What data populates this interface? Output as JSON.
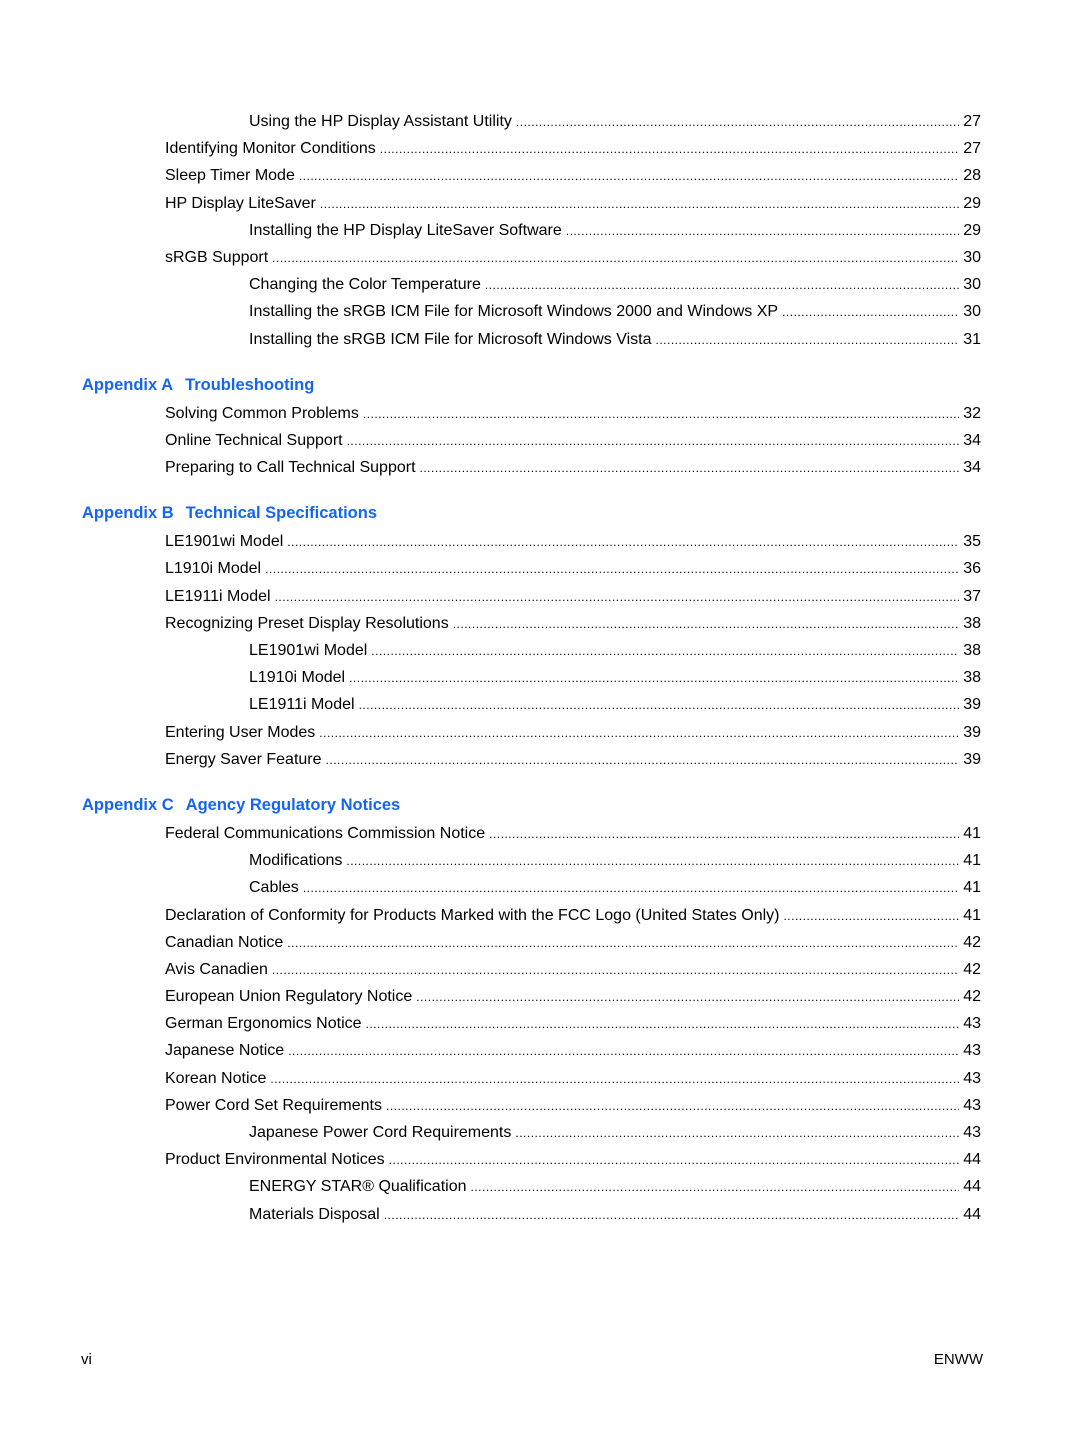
{
  "accent_color": "#1565f0",
  "toc": [
    {
      "type": "entry",
      "level": 2,
      "title": "Using the HP Display Assistant Utility",
      "page": "27"
    },
    {
      "type": "entry",
      "level": 1,
      "title": "Identifying Monitor Conditions",
      "page": "27"
    },
    {
      "type": "entry",
      "level": 1,
      "title": "Sleep Timer Mode",
      "page": "28"
    },
    {
      "type": "entry",
      "level": 1,
      "title": "HP Display LiteSaver",
      "page": "29"
    },
    {
      "type": "entry",
      "level": 2,
      "title": "Installing the HP Display LiteSaver Software",
      "page": "29"
    },
    {
      "type": "entry",
      "level": 1,
      "title": "sRGB Support",
      "page": "30"
    },
    {
      "type": "entry",
      "level": 2,
      "title": "Changing the Color Temperature",
      "page": "30"
    },
    {
      "type": "entry",
      "level": 2,
      "title": "Installing the sRGB ICM File for Microsoft Windows 2000 and Windows XP",
      "page": "30"
    },
    {
      "type": "entry",
      "level": 2,
      "title": "Installing the sRGB ICM File for Microsoft Windows Vista",
      "page": "31"
    },
    {
      "type": "heading",
      "label": "Appendix A",
      "title": "Troubleshooting"
    },
    {
      "type": "entry",
      "level": 1,
      "title": "Solving Common Problems",
      "page": "32"
    },
    {
      "type": "entry",
      "level": 1,
      "title": "Online Technical Support",
      "page": "34"
    },
    {
      "type": "entry",
      "level": 1,
      "title": "Preparing to Call Technical Support",
      "page": "34"
    },
    {
      "type": "heading",
      "label": "Appendix B",
      "title": "Technical Specifications"
    },
    {
      "type": "entry",
      "level": 1,
      "title": "LE1901wi Model",
      "page": "35"
    },
    {
      "type": "entry",
      "level": 1,
      "title": "L1910i Model",
      "page": "36"
    },
    {
      "type": "entry",
      "level": 1,
      "title": "LE1911i Model",
      "page": "37"
    },
    {
      "type": "entry",
      "level": 1,
      "title": "Recognizing Preset Display Resolutions",
      "page": "38"
    },
    {
      "type": "entry",
      "level": 2,
      "title": "LE1901wi Model",
      "page": "38"
    },
    {
      "type": "entry",
      "level": 2,
      "title": "L1910i Model",
      "page": "38"
    },
    {
      "type": "entry",
      "level": 2,
      "title": "LE1911i Model",
      "page": "39"
    },
    {
      "type": "entry",
      "level": 1,
      "title": "Entering User Modes",
      "page": "39"
    },
    {
      "type": "entry",
      "level": 1,
      "title": "Energy Saver Feature",
      "page": "39"
    },
    {
      "type": "heading",
      "label": "Appendix C",
      "title": "Agency Regulatory Notices"
    },
    {
      "type": "entry",
      "level": 1,
      "title": "Federal Communications Commission Notice",
      "page": "41"
    },
    {
      "type": "entry",
      "level": 2,
      "title": "Modifications",
      "page": "41"
    },
    {
      "type": "entry",
      "level": 2,
      "title": "Cables",
      "page": "41"
    },
    {
      "type": "entry",
      "level": 1,
      "title": "Declaration of Conformity for Products Marked with the FCC Logo (United States Only)",
      "page": "41"
    },
    {
      "type": "entry",
      "level": 1,
      "title": "Canadian Notice",
      "page": "42"
    },
    {
      "type": "entry",
      "level": 1,
      "title": "Avis Canadien",
      "page": "42"
    },
    {
      "type": "entry",
      "level": 1,
      "title": "European Union Regulatory Notice",
      "page": "42"
    },
    {
      "type": "entry",
      "level": 1,
      "title": "German Ergonomics Notice",
      "page": "43"
    },
    {
      "type": "entry",
      "level": 1,
      "title": "Japanese Notice",
      "page": "43"
    },
    {
      "type": "entry",
      "level": 1,
      "title": "Korean Notice",
      "page": "43"
    },
    {
      "type": "entry",
      "level": 1,
      "title": "Power Cord Set Requirements",
      "page": "43"
    },
    {
      "type": "entry",
      "level": 2,
      "title": "Japanese Power Cord Requirements",
      "page": "43"
    },
    {
      "type": "entry",
      "level": 1,
      "title": "Product Environmental Notices",
      "page": "44"
    },
    {
      "type": "entry",
      "level": 2,
      "title": "ENERGY STAR® Qualification",
      "page": "44"
    },
    {
      "type": "entry",
      "level": 2,
      "title": "Materials Disposal",
      "page": "44"
    }
  ],
  "footer": {
    "page_number": "vi",
    "doc_code": "ENWW"
  }
}
